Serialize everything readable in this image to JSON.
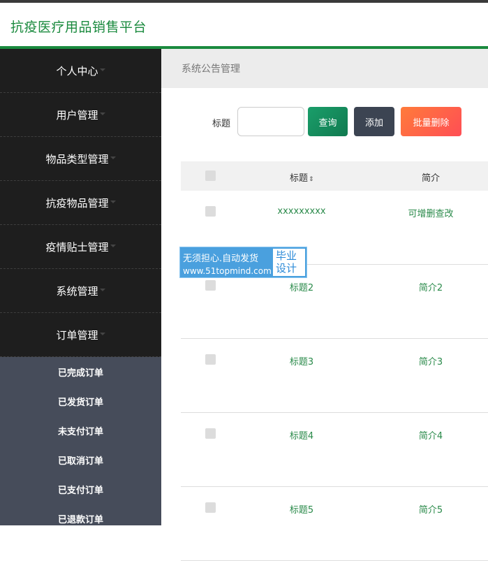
{
  "app": {
    "title": "抗疫医疗用品销售平台"
  },
  "sidebar": {
    "items": [
      {
        "label": "个人中心"
      },
      {
        "label": "用户管理"
      },
      {
        "label": "物品类型管理"
      },
      {
        "label": "抗疫物品管理"
      },
      {
        "label": "疫情贴士管理"
      },
      {
        "label": "系统管理"
      },
      {
        "label": "订单管理"
      }
    ],
    "submenu": [
      {
        "label": "已完成订单"
      },
      {
        "label": "已发货订单"
      },
      {
        "label": "未支付订单"
      },
      {
        "label": "已取消订单"
      },
      {
        "label": "已支付订单"
      },
      {
        "label": "已退款订单"
      }
    ]
  },
  "breadcrumb": {
    "text": "系统公告管理"
  },
  "toolbar": {
    "title_label": "标题",
    "search_value": "",
    "search_label": "查询",
    "add_label": "添加",
    "batch_delete_label": "批量删除"
  },
  "table": {
    "headers": {
      "title": "标题",
      "sort_icon": "⇕",
      "intro": "简介"
    },
    "rows": [
      {
        "title": "xxxxxxxxx",
        "intro": "可增删查改"
      },
      {
        "title": "标题2",
        "intro": "简介2"
      },
      {
        "title": "标题3",
        "intro": "简介3"
      },
      {
        "title": "标题4",
        "intro": "简介4"
      },
      {
        "title": "标题5",
        "intro": "简介5"
      }
    ]
  },
  "watermark": {
    "line1": "无须担心.自动发货",
    "line2": "www.51topmind.com",
    "box_line1": "毕业",
    "box_line2": "设计"
  },
  "colors": {
    "accent": "#1a8a3e",
    "sidebar": "#1e1e1e",
    "submenu": "#464c5a"
  }
}
